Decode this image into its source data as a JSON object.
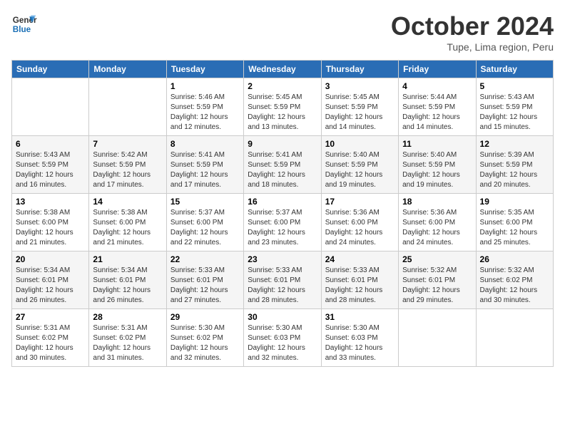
{
  "header": {
    "logo_line1": "General",
    "logo_line2": "Blue",
    "title": "October 2024",
    "subtitle": "Tupe, Lima region, Peru"
  },
  "calendar": {
    "days_of_week": [
      "Sunday",
      "Monday",
      "Tuesday",
      "Wednesday",
      "Thursday",
      "Friday",
      "Saturday"
    ],
    "weeks": [
      [
        {
          "day": "",
          "detail": ""
        },
        {
          "day": "",
          "detail": ""
        },
        {
          "day": "1",
          "detail": "Sunrise: 5:46 AM\nSunset: 5:59 PM\nDaylight: 12 hours and 12 minutes."
        },
        {
          "day": "2",
          "detail": "Sunrise: 5:45 AM\nSunset: 5:59 PM\nDaylight: 12 hours and 13 minutes."
        },
        {
          "day": "3",
          "detail": "Sunrise: 5:45 AM\nSunset: 5:59 PM\nDaylight: 12 hours and 14 minutes."
        },
        {
          "day": "4",
          "detail": "Sunrise: 5:44 AM\nSunset: 5:59 PM\nDaylight: 12 hours and 14 minutes."
        },
        {
          "day": "5",
          "detail": "Sunrise: 5:43 AM\nSunset: 5:59 PM\nDaylight: 12 hours and 15 minutes."
        }
      ],
      [
        {
          "day": "6",
          "detail": "Sunrise: 5:43 AM\nSunset: 5:59 PM\nDaylight: 12 hours and 16 minutes."
        },
        {
          "day": "7",
          "detail": "Sunrise: 5:42 AM\nSunset: 5:59 PM\nDaylight: 12 hours and 17 minutes."
        },
        {
          "day": "8",
          "detail": "Sunrise: 5:41 AM\nSunset: 5:59 PM\nDaylight: 12 hours and 17 minutes."
        },
        {
          "day": "9",
          "detail": "Sunrise: 5:41 AM\nSunset: 5:59 PM\nDaylight: 12 hours and 18 minutes."
        },
        {
          "day": "10",
          "detail": "Sunrise: 5:40 AM\nSunset: 5:59 PM\nDaylight: 12 hours and 19 minutes."
        },
        {
          "day": "11",
          "detail": "Sunrise: 5:40 AM\nSunset: 5:59 PM\nDaylight: 12 hours and 19 minutes."
        },
        {
          "day": "12",
          "detail": "Sunrise: 5:39 AM\nSunset: 5:59 PM\nDaylight: 12 hours and 20 minutes."
        }
      ],
      [
        {
          "day": "13",
          "detail": "Sunrise: 5:38 AM\nSunset: 6:00 PM\nDaylight: 12 hours and 21 minutes."
        },
        {
          "day": "14",
          "detail": "Sunrise: 5:38 AM\nSunset: 6:00 PM\nDaylight: 12 hours and 21 minutes."
        },
        {
          "day": "15",
          "detail": "Sunrise: 5:37 AM\nSunset: 6:00 PM\nDaylight: 12 hours and 22 minutes."
        },
        {
          "day": "16",
          "detail": "Sunrise: 5:37 AM\nSunset: 6:00 PM\nDaylight: 12 hours and 23 minutes."
        },
        {
          "day": "17",
          "detail": "Sunrise: 5:36 AM\nSunset: 6:00 PM\nDaylight: 12 hours and 24 minutes."
        },
        {
          "day": "18",
          "detail": "Sunrise: 5:36 AM\nSunset: 6:00 PM\nDaylight: 12 hours and 24 minutes."
        },
        {
          "day": "19",
          "detail": "Sunrise: 5:35 AM\nSunset: 6:00 PM\nDaylight: 12 hours and 25 minutes."
        }
      ],
      [
        {
          "day": "20",
          "detail": "Sunrise: 5:34 AM\nSunset: 6:01 PM\nDaylight: 12 hours and 26 minutes."
        },
        {
          "day": "21",
          "detail": "Sunrise: 5:34 AM\nSunset: 6:01 PM\nDaylight: 12 hours and 26 minutes."
        },
        {
          "day": "22",
          "detail": "Sunrise: 5:33 AM\nSunset: 6:01 PM\nDaylight: 12 hours and 27 minutes."
        },
        {
          "day": "23",
          "detail": "Sunrise: 5:33 AM\nSunset: 6:01 PM\nDaylight: 12 hours and 28 minutes."
        },
        {
          "day": "24",
          "detail": "Sunrise: 5:33 AM\nSunset: 6:01 PM\nDaylight: 12 hours and 28 minutes."
        },
        {
          "day": "25",
          "detail": "Sunrise: 5:32 AM\nSunset: 6:01 PM\nDaylight: 12 hours and 29 minutes."
        },
        {
          "day": "26",
          "detail": "Sunrise: 5:32 AM\nSunset: 6:02 PM\nDaylight: 12 hours and 30 minutes."
        }
      ],
      [
        {
          "day": "27",
          "detail": "Sunrise: 5:31 AM\nSunset: 6:02 PM\nDaylight: 12 hours and 30 minutes."
        },
        {
          "day": "28",
          "detail": "Sunrise: 5:31 AM\nSunset: 6:02 PM\nDaylight: 12 hours and 31 minutes."
        },
        {
          "day": "29",
          "detail": "Sunrise: 5:30 AM\nSunset: 6:02 PM\nDaylight: 12 hours and 32 minutes."
        },
        {
          "day": "30",
          "detail": "Sunrise: 5:30 AM\nSunset: 6:03 PM\nDaylight: 12 hours and 32 minutes."
        },
        {
          "day": "31",
          "detail": "Sunrise: 5:30 AM\nSunset: 6:03 PM\nDaylight: 12 hours and 33 minutes."
        },
        {
          "day": "",
          "detail": ""
        },
        {
          "day": "",
          "detail": ""
        }
      ]
    ]
  }
}
